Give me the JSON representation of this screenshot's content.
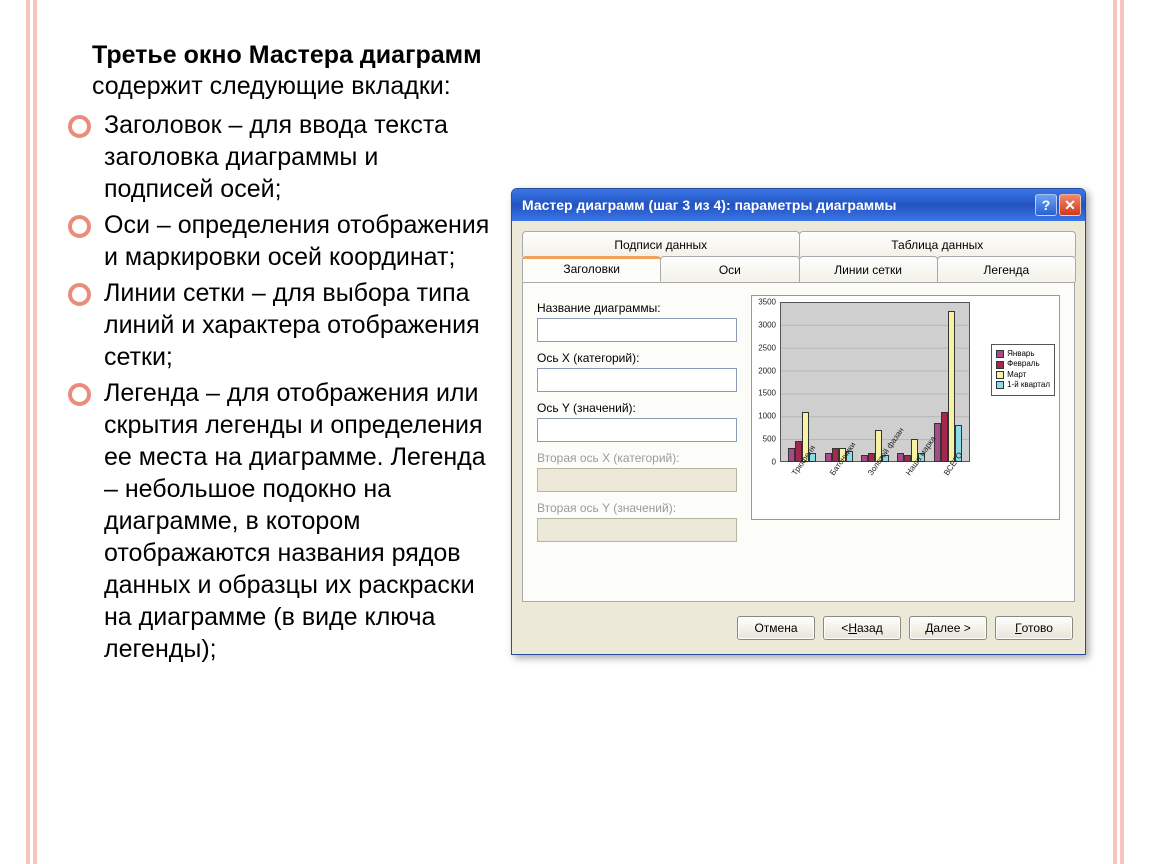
{
  "headline_bold": "Третье окно Мастера диаграмм",
  "headline_rest": " содержит следующие вкладки:",
  "bullets": [
    "Заголовок – для ввода текста заголовка диаграммы и подписей осей;",
    "Оси – определения отображения и маркировки осей координат;",
    "Линии сетки – для выбора типа линий и характера отображения сетки;",
    "Легенда – для отображения или скрытия легенды и определения ее места на диаграмме. Легенда – небольшое подокно на диаграмме, в котором отображаются названия рядов данных и образцы их раскраски на диаграмме (в виде ключа легенды);"
  ],
  "dialog": {
    "title": "Мастер диаграмм (шаг 3 из 4): параметры диаграммы",
    "tabs_row1": [
      "Подписи данных",
      "Таблица данных"
    ],
    "tabs_row2": [
      "Заголовки",
      "Оси",
      "Линии сетки",
      "Легенда"
    ],
    "form": {
      "chart_title_label": "Название диаграммы:",
      "axis_x_label": "Ось X (категорий):",
      "axis_y_label": "Ось Y (значений):",
      "axis_x2_label": "Вторая ось X (категорий):",
      "axis_y2_label": "Вторая ось Y (значений):"
    },
    "buttons": {
      "cancel": "Отмена",
      "back_pre": "< ",
      "back_u": "Н",
      "back_post": "азад",
      "next_pre": "",
      "next_u": "Д",
      "next_post": "алее >",
      "finish_pre": "",
      "finish_u": "Г",
      "finish_post": "отово"
    }
  },
  "chart_data": {
    "type": "bar",
    "categories": [
      "Трюфеля",
      "Батончики",
      "Золотой фазан",
      "Наша марка",
      "ВСЕГО"
    ],
    "series": [
      {
        "name": "Январь",
        "values": [
          300,
          200,
          150,
          200,
          850
        ]
      },
      {
        "name": "Февраль",
        "values": [
          450,
          300,
          200,
          150,
          1100
        ]
      },
      {
        "name": "Март",
        "values": [
          1100,
          300,
          700,
          500,
          3300
        ]
      },
      {
        "name": "1-й квартал",
        "values": [
          200,
          250,
          150,
          200,
          800
        ]
      }
    ],
    "series_colors": [
      "#a64b89",
      "#a6274e",
      "#f6f3a2",
      "#8adde6"
    ],
    "ylim": [
      0,
      3500
    ],
    "yticks": [
      0,
      500,
      1000,
      1500,
      2000,
      2500,
      3000,
      3500
    ]
  }
}
